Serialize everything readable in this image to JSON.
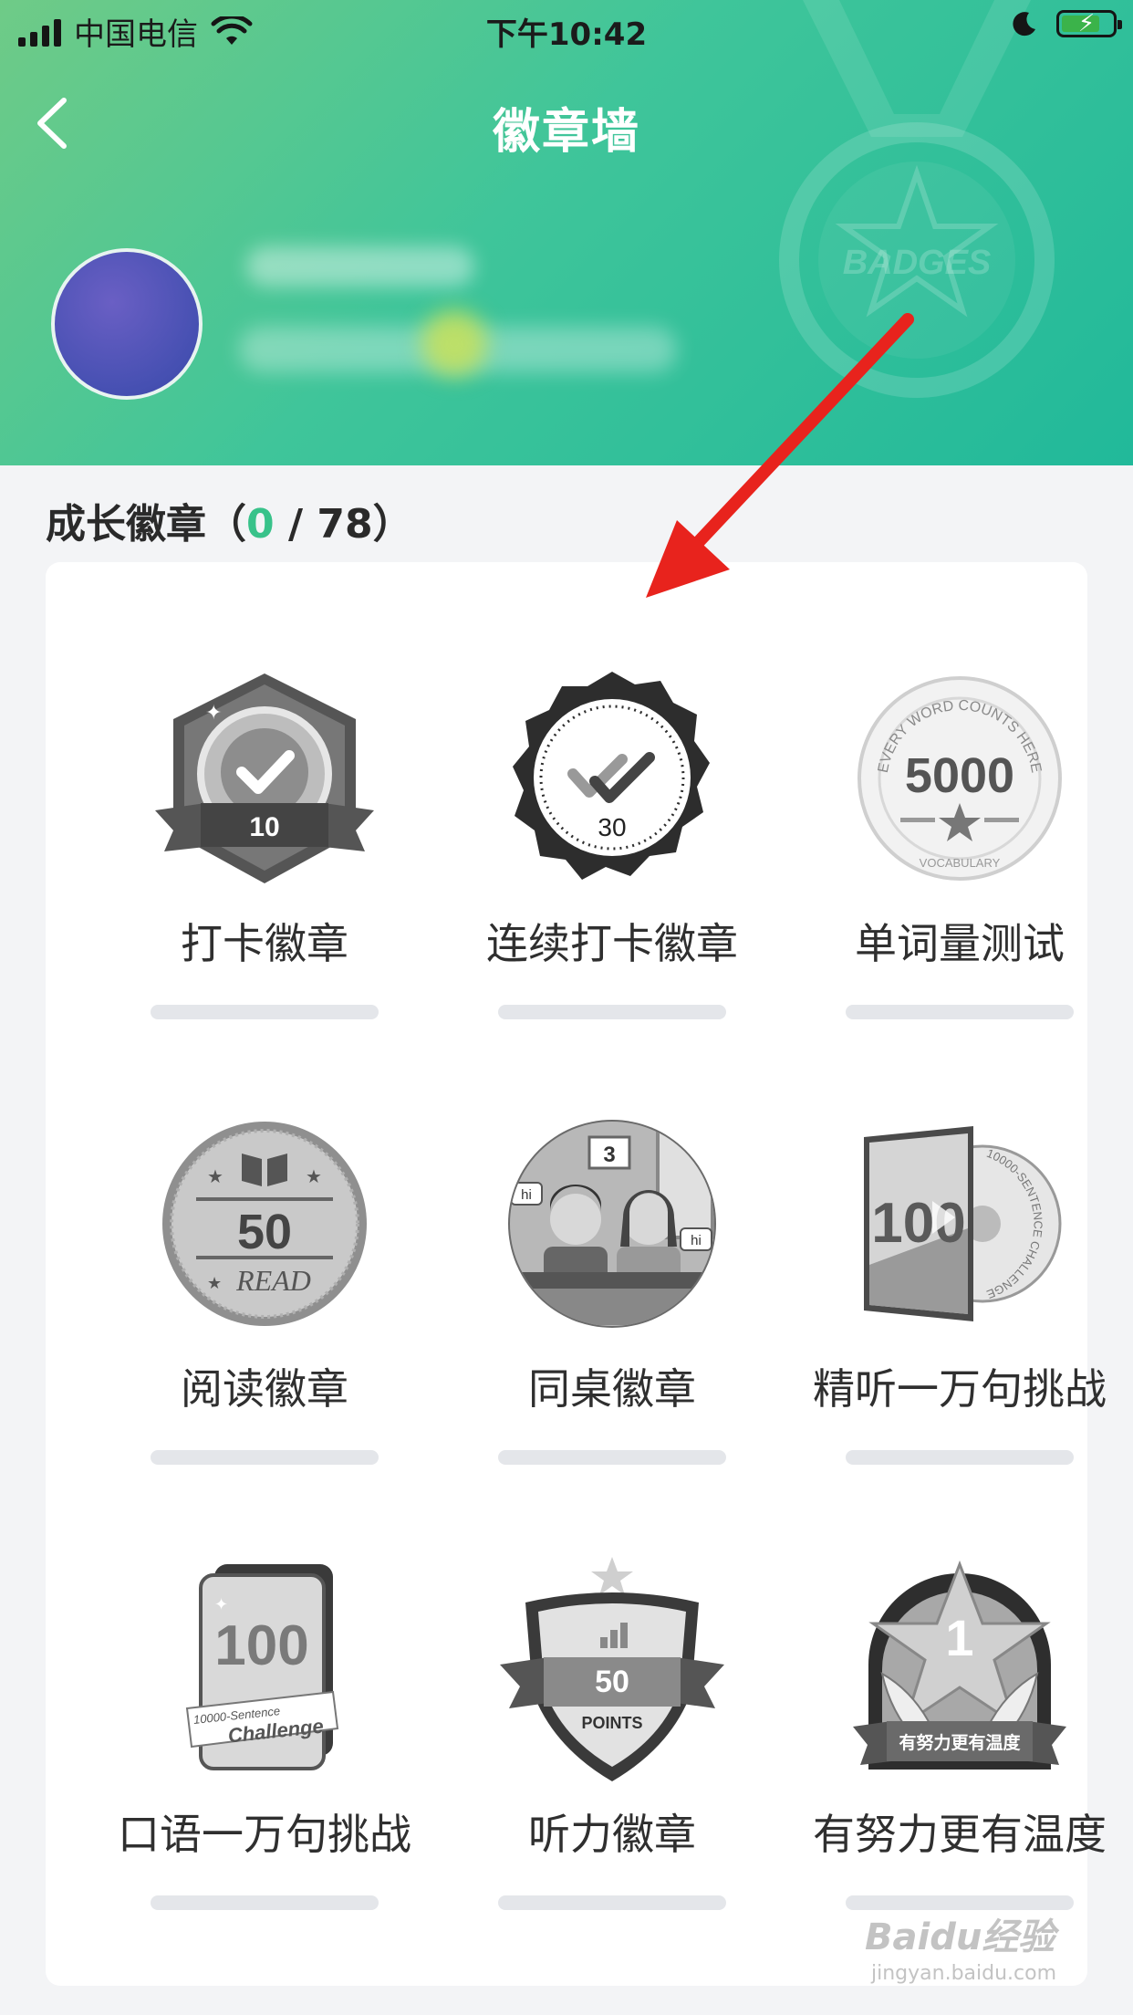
{
  "status_bar": {
    "carrier": "中国电信",
    "time": "下午10:42",
    "battery_level": 0.7
  },
  "nav": {
    "title": "徽章墙",
    "back_icon": "chevron-left-icon"
  },
  "header": {
    "medal_text": "BADGES"
  },
  "section": {
    "title": "成长徽章（",
    "earned": "0",
    "separator": "/",
    "total": "78",
    "close": "）"
  },
  "badges": [
    {
      "name": "打卡徽章",
      "icon": "checkmark-medal-icon",
      "label": "10",
      "progress": 0
    },
    {
      "name": "连续打卡徽章",
      "icon": "double-check-seal-icon",
      "label": "30",
      "progress": 0
    },
    {
      "name": "单词量测试",
      "icon": "vocabulary-coin-icon",
      "label": "5000",
      "arc": "EVERY WORD COUNTS HERE",
      "sub": "VOCABULARY",
      "progress": 0
    },
    {
      "name": "阅读徽章",
      "icon": "book-coin-icon",
      "label": "50",
      "sub": "READ",
      "progress": 0
    },
    {
      "name": "同桌徽章",
      "icon": "deskmates-icon",
      "label": "3",
      "bubble": "hi",
      "progress": 0
    },
    {
      "name": "精听一万句挑战",
      "icon": "listening-record-icon",
      "label": "100",
      "arc": "10000-SENTENCE CHALLENGE",
      "progress": 0
    },
    {
      "name": "口语一万句挑战",
      "icon": "speaking-card-icon",
      "label": "100",
      "sub": "10000-Sentence",
      "sub2": "Challenge",
      "progress": 0
    },
    {
      "name": "听力徽章",
      "icon": "shield-points-icon",
      "label": "50",
      "sub": "POINTS",
      "progress": 0
    },
    {
      "name": "有努力更有温度",
      "icon": "star-hands-icon",
      "label": "1",
      "sub": "有努力更有温度",
      "progress": 0
    }
  ],
  "watermark": {
    "text": "Baidu经验",
    "url": "jingyan.baidu.com"
  },
  "colors": {
    "accent": "#38c28a",
    "header_start": "#6fcb87",
    "header_end": "#21b99a",
    "arrow": "#e8231d"
  }
}
